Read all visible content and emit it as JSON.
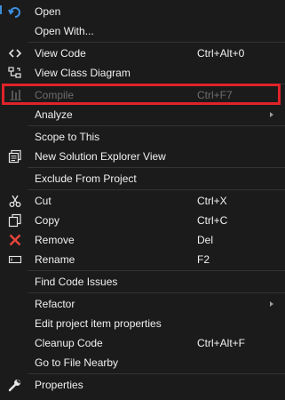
{
  "menu": {
    "items": [
      {
        "label": "Open",
        "shortcut": "",
        "icon": "open-arrow-icon",
        "disabled": false
      },
      {
        "label": "Open With...",
        "shortcut": "",
        "icon": "",
        "disabled": false
      },
      {
        "label": "View Code",
        "shortcut": "Ctrl+Alt+0",
        "icon": "code-brackets-icon",
        "disabled": false
      },
      {
        "label": "View Class Diagram",
        "shortcut": "",
        "icon": "class-diagram-icon",
        "disabled": false
      },
      {
        "label": "Compile",
        "shortcut": "Ctrl+F7",
        "icon": "compile-icon",
        "disabled": true
      },
      {
        "label": "Analyze",
        "shortcut": "",
        "icon": "",
        "disabled": false,
        "submenu": true
      },
      {
        "label": "Scope to This",
        "shortcut": "",
        "icon": "",
        "disabled": false
      },
      {
        "label": "New Solution Explorer View",
        "shortcut": "",
        "icon": "solution-explorer-icon",
        "disabled": false
      },
      {
        "label": "Exclude From Project",
        "shortcut": "",
        "icon": "",
        "disabled": false
      },
      {
        "label": "Cut",
        "shortcut": "Ctrl+X",
        "icon": "scissors-icon",
        "disabled": false
      },
      {
        "label": "Copy",
        "shortcut": "Ctrl+C",
        "icon": "copy-icon",
        "disabled": false
      },
      {
        "label": "Remove",
        "shortcut": "Del",
        "icon": "remove-x-icon",
        "disabled": false
      },
      {
        "label": "Rename",
        "shortcut": "F2",
        "icon": "rename-icon",
        "disabled": false
      },
      {
        "label": "Find Code Issues",
        "shortcut": "",
        "icon": "",
        "disabled": false
      },
      {
        "label": "Refactor",
        "shortcut": "",
        "icon": "",
        "disabled": false,
        "submenu": true
      },
      {
        "label": "Edit project item properties",
        "shortcut": "",
        "icon": "",
        "disabled": false
      },
      {
        "label": "Cleanup Code",
        "shortcut": "Ctrl+Alt+F",
        "icon": "",
        "disabled": false
      },
      {
        "label": "Go to File Nearby",
        "shortcut": "",
        "icon": "",
        "disabled": false
      },
      {
        "label": "Properties",
        "shortcut": "",
        "icon": "wrench-icon",
        "disabled": false
      }
    ]
  },
  "colors": {
    "background": "#1b1b1c",
    "text": "#f1f1f1",
    "disabled_text": "#6d6d6d",
    "separator": "#333337",
    "highlight": "#e0232a",
    "remove_icon": "#e8453c"
  }
}
